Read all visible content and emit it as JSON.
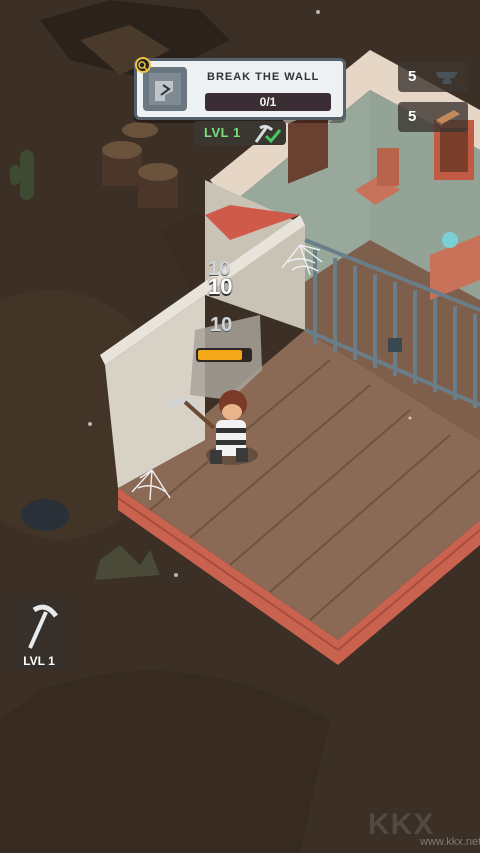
{
  "quest": {
    "title": "BREAK THE WALL",
    "progress": "0/1"
  },
  "player_level": {
    "label": "LVL 1"
  },
  "resources": [
    {
      "name": "iron",
      "count": "5",
      "icon": "anvil-icon"
    },
    {
      "name": "wood",
      "count": "5",
      "icon": "plank-icon"
    }
  ],
  "damage_numbers": [
    "10",
    "10",
    "10"
  ],
  "wall_health": 0.85,
  "tool": {
    "label": "LVL 1",
    "icon": "pickaxe-icon"
  },
  "watermark": {
    "logo": "KKX",
    "text": "www.kkx.net"
  },
  "colors": {
    "accent_green": "#7be07a",
    "health_bar": "#f2a818",
    "floor": "#8a6a54"
  }
}
